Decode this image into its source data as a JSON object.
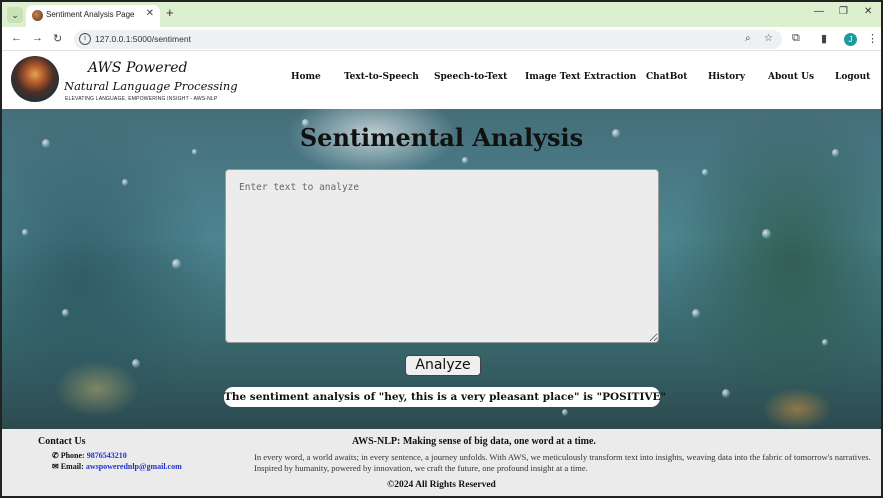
{
  "browser": {
    "tab_title": "Sentiment Analysis Page",
    "url": "127.0.0.1:5000/sentiment",
    "profile_initial": "J",
    "icons": [
      "tab-list-icon",
      "close-icon",
      "plus-icon",
      "minimize-icon",
      "restore-icon",
      "close-window-icon",
      "back-icon",
      "forward-icon",
      "reload-icon",
      "info-icon",
      "zoom-icon",
      "star-icon",
      "extensions-icon",
      "side-panel-icon",
      "menu-icon"
    ]
  },
  "site": {
    "logo_title_1": "AWS Powered",
    "logo_title_2": "Natural Language Processing",
    "logo_tagline": "ELEVATING LANGUAGE, EMPOWERING INSIGHT - AWS-NLP",
    "nav": [
      "Home",
      "Text-to-Speech",
      "Speech-to-Text",
      "Image Text Extraction",
      "ChatBot",
      "History",
      "About Us",
      "Logout"
    ]
  },
  "main": {
    "title": "Sentimental Analysis",
    "textarea_placeholder": "Enter text to analyze",
    "textarea_value": "",
    "analyze_label": "Analyze",
    "result_text": "The sentiment analysis of \"hey, this is a very pleasant place\" is \"POSITIVE\""
  },
  "footer": {
    "contact_title": "Contact Us",
    "phone_label": "Phone:",
    "phone_value": "9876543210",
    "email_label": "Email:",
    "email_value": "awspowerednlp@gmail.com",
    "about_title": "AWS-NLP: Making sense of big data, one word at a time.",
    "about_text": "In every word, a world awaits; in every sentence, a journey unfolds. With AWS, we meticulously transform text into insights, weaving data into the fabric of tomorrow's narratives. Inspired by humanity, powered by innovation, we craft the future, one profound insight at a time.",
    "copyright": "©2024 All Rights Reserved"
  },
  "colors": {
    "tabbar": "#dcefcf",
    "link": "#2233cc",
    "footer_bg": "#ebebeb"
  }
}
